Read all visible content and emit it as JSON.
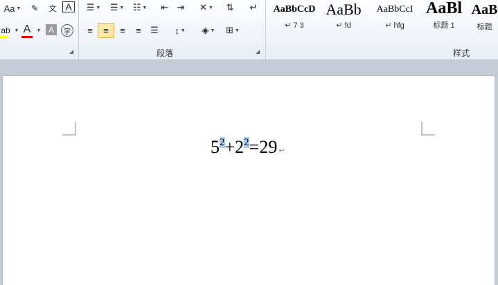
{
  "ribbon": {
    "font_size_label": "Aa",
    "paragraph_group_label": "段落",
    "styles_group_label": "样式",
    "styles": [
      {
        "sample": "AaBbCcD",
        "name": "↵ 7 3"
      },
      {
        "sample": "AaBb",
        "name": "↵ fd"
      },
      {
        "sample": "AaBbCcI",
        "name": "↵ hfg"
      },
      {
        "sample": "AaBl",
        "name": "标题 1"
      },
      {
        "sample": "AaB",
        "name": "标题"
      }
    ],
    "colors": {
      "highlight": "#ffff00",
      "font_color": "#e00000",
      "selected_button": "#fde9a3"
    }
  },
  "document": {
    "equation": {
      "base1": "5",
      "exp1": "2",
      "op1": "+",
      "base2": "2",
      "exp2": "2",
      "op2": "=",
      "result": "29"
    },
    "paragraph_mark": "↵"
  }
}
